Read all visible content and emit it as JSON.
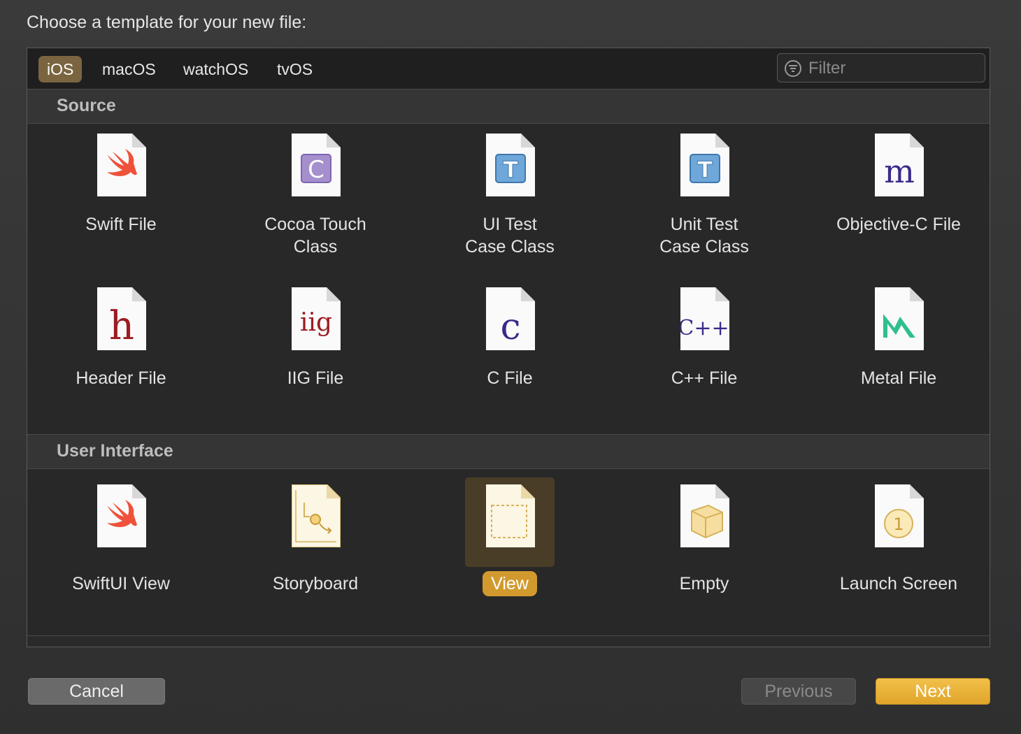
{
  "dialog": {
    "prompt": "Choose a template for your new file:"
  },
  "tabs": [
    {
      "label": "iOS",
      "active": true
    },
    {
      "label": "macOS",
      "active": false
    },
    {
      "label": "watchOS",
      "active": false
    },
    {
      "label": "tvOS",
      "active": false
    }
  ],
  "filter": {
    "placeholder": "Filter",
    "value": ""
  },
  "sections": [
    {
      "title": "Source",
      "items": [
        {
          "line1": "Swift File",
          "line2": "",
          "icon": "swift-icon"
        },
        {
          "line1": "Cocoa Touch",
          "line2": "Class",
          "icon": "cocoa-class-icon"
        },
        {
          "line1": "UI Test",
          "line2": "Case Class",
          "icon": "ui-test-icon"
        },
        {
          "line1": "Unit Test",
          "line2": "Case Class",
          "icon": "unit-test-icon"
        },
        {
          "line1": "Objective-C File",
          "line2": "",
          "icon": "objc-m-icon"
        },
        {
          "line1": "Header File",
          "line2": "",
          "icon": "header-h-icon"
        },
        {
          "line1": "IIG File",
          "line2": "",
          "icon": "iig-icon"
        },
        {
          "line1": "C File",
          "line2": "",
          "icon": "c-file-icon"
        },
        {
          "line1": "C++ File",
          "line2": "",
          "icon": "cpp-file-icon"
        },
        {
          "line1": "Metal File",
          "line2": "",
          "icon": "metal-icon"
        }
      ]
    },
    {
      "title": "User Interface",
      "items": [
        {
          "line1": "SwiftUI View",
          "line2": "",
          "icon": "swift-icon"
        },
        {
          "line1": "Storyboard",
          "line2": "",
          "icon": "storyboard-icon"
        },
        {
          "line1": "View",
          "line2": "",
          "icon": "view-icon",
          "selected": true
        },
        {
          "line1": "Empty",
          "line2": "",
          "icon": "empty-cube-icon"
        },
        {
          "line1": "Launch Screen",
          "line2": "",
          "icon": "launch-screen-icon"
        }
      ]
    }
  ],
  "glyphs": {
    "cocoa_letter": "C",
    "test_letter": "T",
    "objc_letter": "m",
    "header_letter": "h",
    "iig_letters": "iig",
    "c_letter": "c",
    "cpp_letters": "C++",
    "launch_number": "1"
  },
  "buttons": {
    "cancel": "Cancel",
    "previous": "Previous",
    "next": "Next"
  },
  "colors": {
    "accent": "#d29a2e",
    "tab_active": "#7a6540",
    "next_button": "#e8b23a"
  }
}
